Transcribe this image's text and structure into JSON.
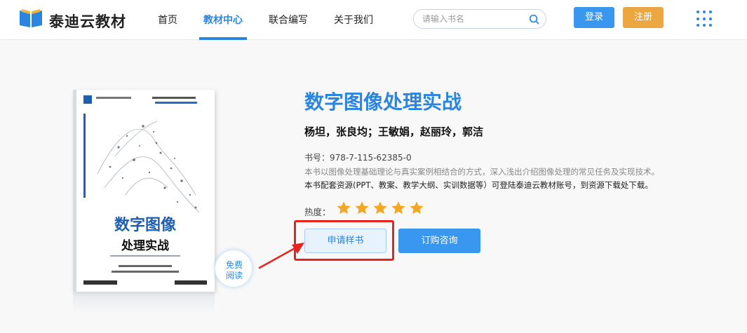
{
  "header": {
    "brand": "泰迪云教材",
    "nav": [
      {
        "label": "首页",
        "active": false
      },
      {
        "label": "教材中心",
        "active": true
      },
      {
        "label": "联合编写",
        "active": false
      },
      {
        "label": "关于我们",
        "active": false
      }
    ],
    "search": {
      "placeholder": "请输入书名",
      "value": "",
      "icon": "search-icon"
    },
    "login_label": "登录",
    "register_label": "注册",
    "menu_icon": "grid-menu-icon"
  },
  "book": {
    "title": "数字图像处理实战",
    "authors": "杨坦，张良均；王敏娟，赵丽玲，郭洁",
    "isbn": "书号：978-7-115-62385-0",
    "description": "本书以图像处理基础理论与真实案例相结合的方式，深入浅出介绍图像处理的常见任务及实现技术。",
    "resources": "本书配套资源(PPT、教案、教学大纲、实训数据等）可登陆泰迪云教材账号，到资源下载处下载。",
    "heat_label": "热度：",
    "rating": 5,
    "rating_max": 5,
    "free_read_line1": "免费",
    "free_read_line2": "阅读",
    "cover": {
      "title_line1": "数字图像",
      "title_line2": "处理实战"
    }
  },
  "actions": {
    "sample_label": "申请样书",
    "order_label": "订购咨询"
  },
  "colors": {
    "accent": "#2a85e0",
    "button_blue": "#3a97f0",
    "button_orange": "#eda740",
    "star": "#f5a623",
    "highlight_red": "#e8231d"
  }
}
